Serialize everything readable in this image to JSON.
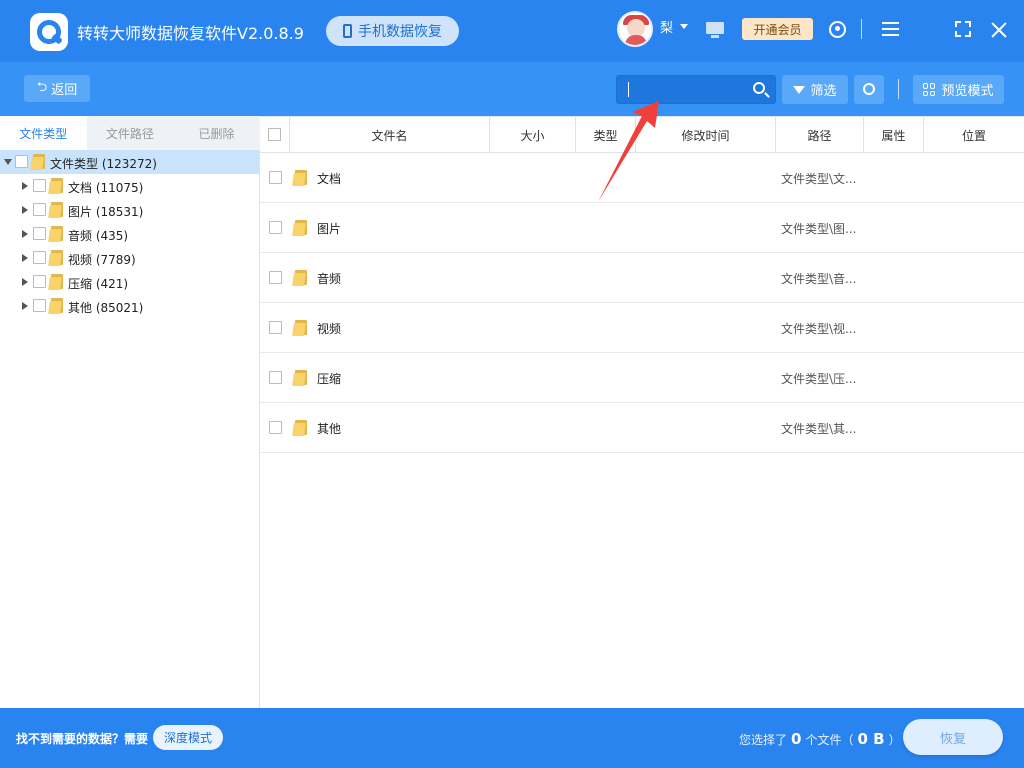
{
  "app": {
    "title": "转转大师数据恢复软件V2.0.8.9",
    "phone_recovery_label": "手机数据恢复",
    "username": "梨",
    "vip_label": "开通会员"
  },
  "toolbar": {
    "back_label": "返回",
    "search_value": "",
    "filter_label": "筛选",
    "preview_label": "预览模式"
  },
  "sidebar": {
    "tabs": [
      "文件类型",
      "文件路径",
      "已删除"
    ],
    "active_tab": 0,
    "root": {
      "label": "文件类型 (123272)"
    },
    "items": [
      {
        "label": "文档 (11075)"
      },
      {
        "label": "图片 (18531)"
      },
      {
        "label": "音频 (435)"
      },
      {
        "label": "视频 (7789)"
      },
      {
        "label": "压缩 (421)"
      },
      {
        "label": "其他 (85021)"
      }
    ]
  },
  "table": {
    "columns": [
      "文件名",
      "大小",
      "类型",
      "修改时间",
      "路径",
      "属性",
      "位置"
    ],
    "rows": [
      {
        "name": "文档",
        "path": "文件类型\\文..."
      },
      {
        "name": "图片",
        "path": "文件类型\\图..."
      },
      {
        "name": "音频",
        "path": "文件类型\\音..."
      },
      {
        "name": "视频",
        "path": "文件类型\\视..."
      },
      {
        "name": "压缩",
        "path": "文件类型\\压..."
      },
      {
        "name": "其他",
        "path": "文件类型\\其..."
      }
    ]
  },
  "footer": {
    "hint": "找不到需要的数据？需要",
    "deep_mode_label": "深度模式",
    "selected_prefix": "您选择了",
    "selected_count": "0",
    "selected_mid": "个文件（",
    "selected_size": "0 B",
    "selected_suffix": "）",
    "recover_label": "恢复"
  },
  "colors": {
    "primary": "#2a84f0",
    "toolbar": "#3693f5",
    "annotation_arrow": "#f0403c"
  }
}
